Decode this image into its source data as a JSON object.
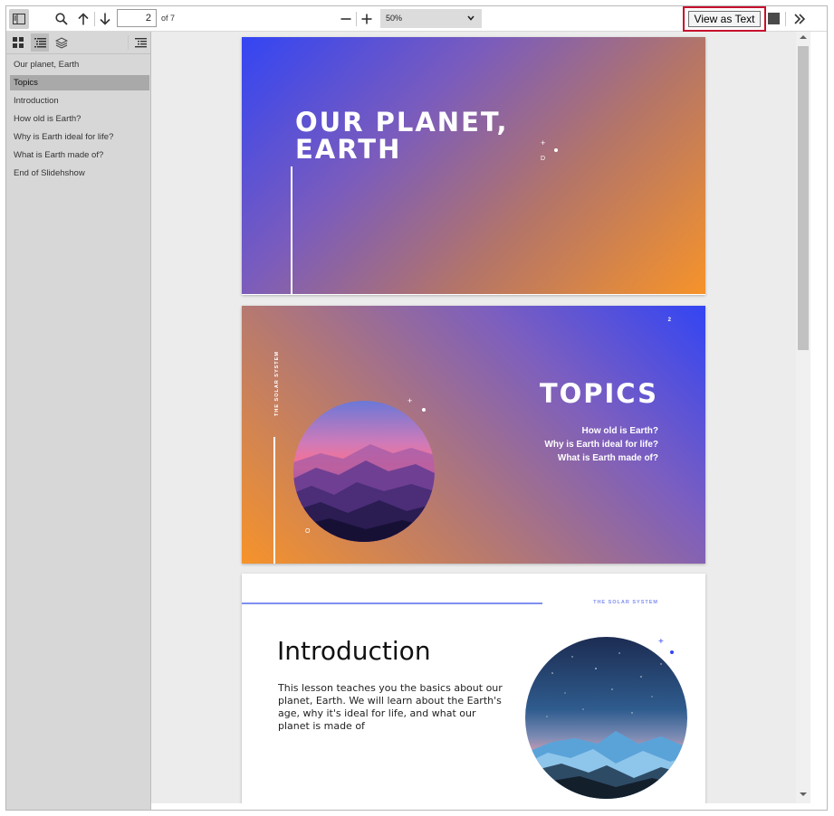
{
  "toolbar": {
    "current_page": "2",
    "page_count_label": "of 7",
    "zoom_value": "50%",
    "view_as_text_label": "View as Text"
  },
  "sidebar": {
    "outline": [
      "Our planet, Earth",
      "Topics",
      "Introduction",
      "How old is Earth?",
      "Why is Earth ideal for life?",
      "What is Earth made of?",
      "End of Slidehshow"
    ],
    "selected_index": 1
  },
  "slides": {
    "slide1": {
      "title": "OUR PLANET, EARTH",
      "deco_letter": "D"
    },
    "slide2": {
      "number": "2",
      "vertical_label": "THE SOLAR SYSTEM",
      "title": "TOPICS",
      "topics": [
        "How old is Earth?",
        "Why is Earth ideal for life?",
        "What is Earth made of?"
      ],
      "deco_letter": "O"
    },
    "slide3": {
      "tag": "THE SOLAR SYSTEM",
      "title": "Introduction",
      "body": "This lesson teaches you the basics about our planet, Earth. We will learn about the Earth's age, why it's ideal for life, and what our planet is made of"
    }
  },
  "colors": {
    "highlight_border": "#c8102e",
    "accent_line": "#7f8ff0"
  }
}
